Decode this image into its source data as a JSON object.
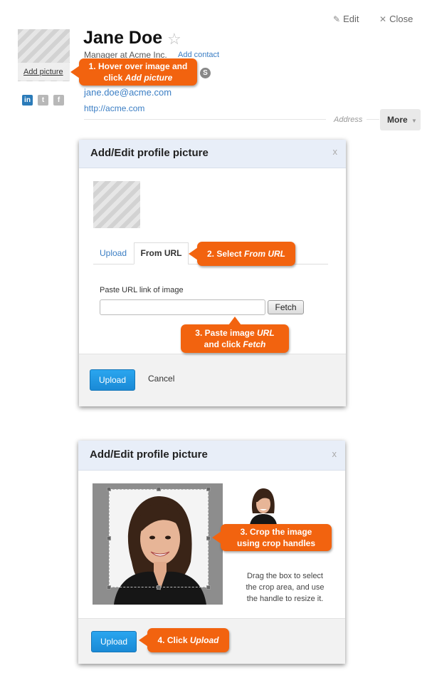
{
  "header": {
    "edit_label": "Edit",
    "close_label": "Close"
  },
  "profile": {
    "name": "Jane Doe",
    "title": "Manager at Acme Inc.",
    "add_contact": "Add contact",
    "add_picture": "Add picture",
    "email": "jane.doe@acme.com",
    "website": "http://acme.com",
    "address_label": "Address",
    "more_label": "More",
    "social_icons": [
      "linkedin-icon",
      "twitter-icon",
      "facebook-icon"
    ]
  },
  "callouts": {
    "c1_line1": "1. Hover over image and",
    "c1_line2a": "click ",
    "c1_line2b": "Add picture",
    "c2a": "2. Select ",
    "c2b": "From URL",
    "c3_line1a": "3. Paste image ",
    "c3_line1b": "URL",
    "c3_line2a": "and click ",
    "c3_line2b": "Fetch",
    "c4_line1": "3. Crop the image",
    "c4_line2": "using crop handles",
    "c5a": "4. Click ",
    "c5b": "Upload"
  },
  "dialog1": {
    "title": "Add/Edit profile picture",
    "close": "x",
    "tab_upload": "Upload",
    "tab_from_url": "From URL",
    "url_label": "Paste URL link of image",
    "url_value": "",
    "fetch_label": "Fetch",
    "upload_label": "Upload",
    "cancel_label": "Cancel"
  },
  "dialog2": {
    "title": "Add/Edit profile picture",
    "close": "x",
    "help_line1": "Drag the box to select",
    "help_line2": "the crop area, and use",
    "help_line3": "the handle to resize it.",
    "upload_label": "Upload"
  },
  "colors": {
    "accent_orange": "#f2630f",
    "link_blue": "#3b7ec4",
    "button_blue": "#1a8ad6",
    "dialog_header": "#e8eef8"
  }
}
